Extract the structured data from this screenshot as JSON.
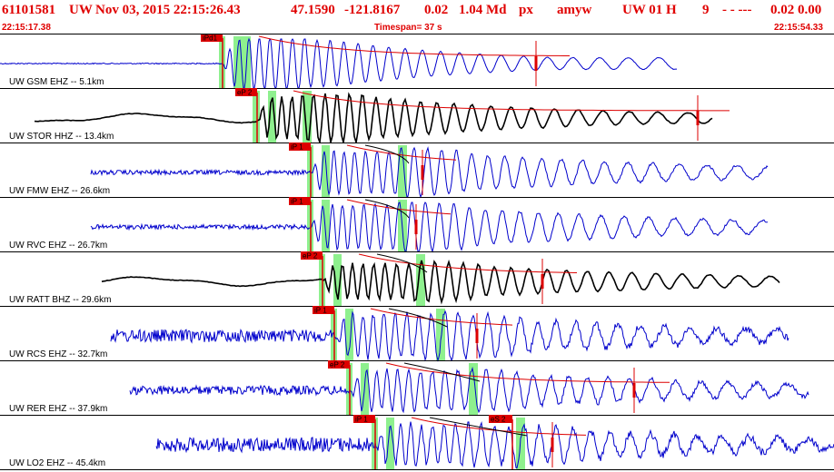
{
  "header": {
    "event_id": "61101581",
    "network": "UW",
    "datetime": "Nov 03, 2015 22:15:26.43",
    "lat": "47.1590",
    "lon": "-121.8167",
    "depth": "0.02",
    "magnitude": "1.04 Md",
    "event_type": "px",
    "analyst": "amyw",
    "source": "UW 01 H",
    "phase_count": "9",
    "flags": "- - ---",
    "trailing": "0.02 0.00"
  },
  "timebar": {
    "start_time": "22:15:17.38",
    "timespan": "Timespan= 37 s",
    "end_time": "22:15:54.33"
  },
  "colors": {
    "header_text": "#e00000",
    "trace_blue": "#0000cc",
    "trace_black": "#000000",
    "pick": "#dd0000",
    "shade": "#8ef08e",
    "divider": "#000000"
  },
  "channels": [
    {
      "label": "UW GSM EHZ -- 5.1km",
      "pick": "iPd1",
      "color": "#0000cc"
    },
    {
      "label": "UW STOR HHZ -- 13.4km",
      "pick": "eP 2",
      "color": "#000000"
    },
    {
      "label": "UW FMW EHZ -- 26.6km",
      "pick": "iP 1",
      "color": "#0000cc"
    },
    {
      "label": "UW RVC EHZ -- 26.7km",
      "pick": "iP 1",
      "color": "#0000cc"
    },
    {
      "label": "UW RATT BHZ -- 29.6km",
      "pick": "eP 2",
      "color": "#000000"
    },
    {
      "label": "UW RCS EHZ -- 32.7km",
      "pick": "iP 1",
      "color": "#0000cc"
    },
    {
      "label": "UW RER EHZ -- 37.9km",
      "pick": "eP 2",
      "color": "#0000cc"
    },
    {
      "label": "UW LO2 EHZ -- 45.4km",
      "pick": "iP 1",
      "color": "#0000cc",
      "extra_pick": "eS 2"
    }
  ]
}
